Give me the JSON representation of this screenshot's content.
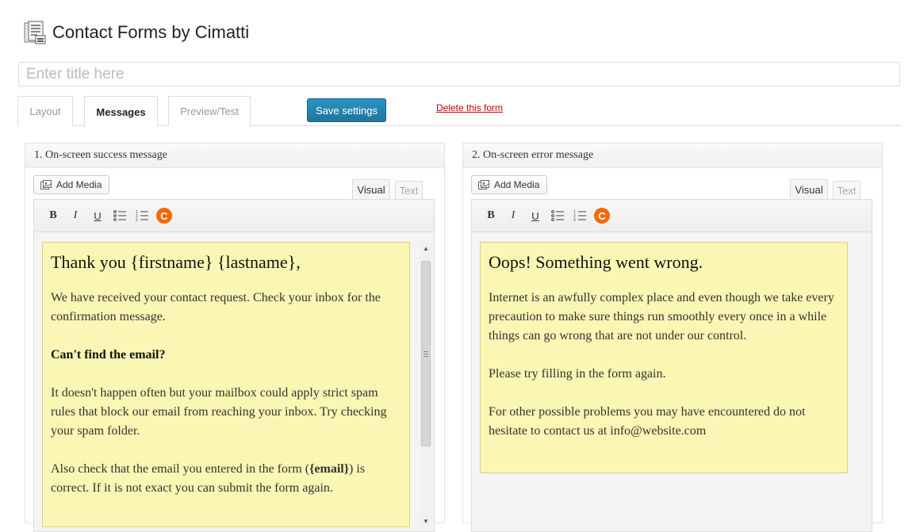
{
  "header": {
    "title": "Contact Forms by Cimatti",
    "icon": "forms-icon"
  },
  "title_field": {
    "placeholder": "Enter title here",
    "value": ""
  },
  "tabs": [
    {
      "label": "Layout",
      "active": false
    },
    {
      "label": "Messages",
      "active": true
    },
    {
      "label": "Preview/Test",
      "active": false
    }
  ],
  "actions": {
    "save_label": "Save settings",
    "delete_label": "Delete this form"
  },
  "panels": [
    {
      "title": "1. On-screen success message",
      "add_media": "Add Media",
      "mode_visual": "Visual",
      "mode_text": "Text",
      "heading": "Thank you {firstname} {lastname},",
      "paragraphs": [
        "We have received your contact request. Check your inbox for the confirmation message.",
        "Can't find the email?",
        "It doesn't happen often but your mailbox could apply strict spam rules that block our email from reaching your inbox. Try checking your spam folder.",
        "Also check that the email you entered in the form (",
        "{email}",
        ") is correct. If it is not exact you can submit the form again."
      ]
    },
    {
      "title": "2. On-screen error message",
      "add_media": "Add Media",
      "mode_visual": "Visual",
      "mode_text": "Text",
      "heading": "Oops! Something went wrong.",
      "paragraphs": [
        "Internet is an awfully complex place and even though we take every precaution to make sure things run smoothly every once in a while things can go wrong that are not under our control.",
        "Please try filling in the form again.",
        "For other possible problems you may have encountered do not hesitate to contact us at info@website.com"
      ]
    }
  ],
  "toolbar": {
    "bold": "B",
    "italic": "I",
    "underline": "U",
    "cimatti": "C"
  },
  "colors": {
    "accent": "#21759b",
    "delete": "#cc0000",
    "note_bg": "#faf6b3",
    "cimatti": "#f56a00"
  }
}
